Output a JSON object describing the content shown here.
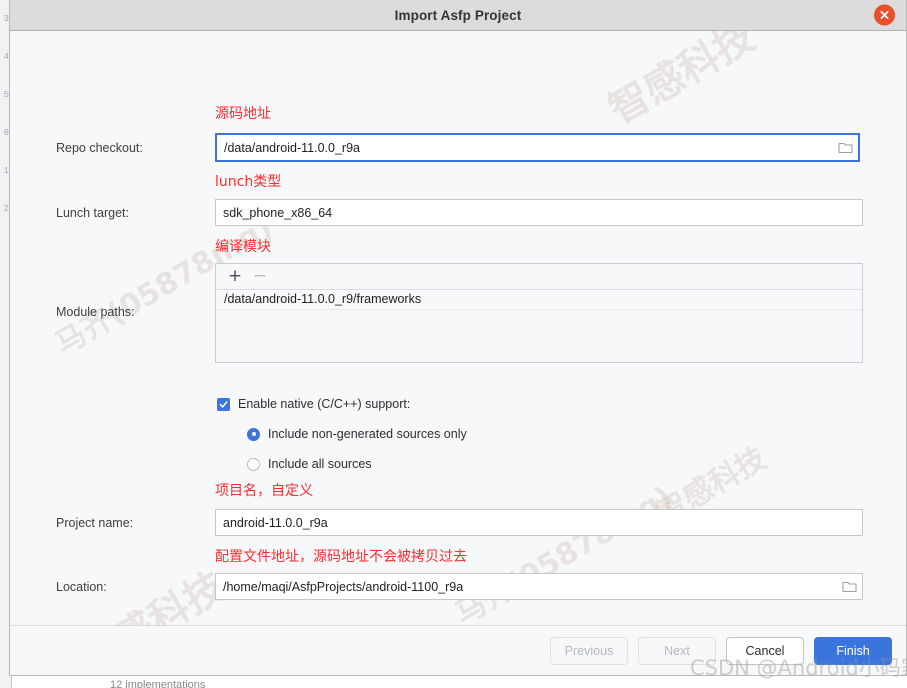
{
  "window": {
    "title": "Import Asfp Project",
    "close_icon": "close-icon"
  },
  "fields": {
    "repo_checkout": {
      "label": "Repo checkout:",
      "value": "/data/android-11.0.0_r9a",
      "annotation": "源码地址",
      "browse_icon": "folder-icon",
      "focused": true
    },
    "lunch_target": {
      "label": "Lunch target:",
      "value": "sdk_phone_x86_64",
      "annotation": "lunch类型"
    },
    "module_paths": {
      "label": "Module paths:",
      "annotation": "编译模块",
      "add_label": "+",
      "remove_label": "−",
      "items": [
        "/data/android-11.0.0_r9/frameworks"
      ]
    },
    "project_name": {
      "label": "Project name:",
      "value": "android-11.0.0_r9a",
      "annotation": "项目名，自定义"
    },
    "location": {
      "label": "Location:",
      "value": "/home/maqi/AsfpProjects/android-1100_r9a",
      "annotation": "配置文件地址，源码地址不会被拷贝过去",
      "browse_icon": "folder-icon"
    }
  },
  "native": {
    "checkbox_label": "Enable native (C/C++) support:",
    "checkbox_checked": true,
    "radios": [
      {
        "label": "Include non-generated sources only",
        "selected": true
      },
      {
        "label": "Include all sources",
        "selected": false
      }
    ]
  },
  "footer": {
    "previous_label": "Previous",
    "previous_disabled": true,
    "next_label": "Next",
    "next_disabled": true,
    "cancel_label": "Cancel",
    "finish_label": "Finish"
  },
  "background": {
    "editor_status_text": "12 implementations",
    "gutter_lines": [
      "3",
      "4",
      "5",
      "6",
      "1",
      "2"
    ]
  },
  "watermarks": {
    "csdn": "CSDN @Android小码家",
    "tiles": [
      "智感科技",
      "智感科技",
      "马齐(05878mq)",
      "马齐(05878mq)",
      "智感科技"
    ]
  },
  "colors": {
    "accent": "#3c74dd",
    "annotation_red": "#fb2d2d",
    "close_orange": "#e8502a",
    "dialog_bg": "#f7f8fa",
    "titlebar_bg": "#dcdcdc"
  }
}
